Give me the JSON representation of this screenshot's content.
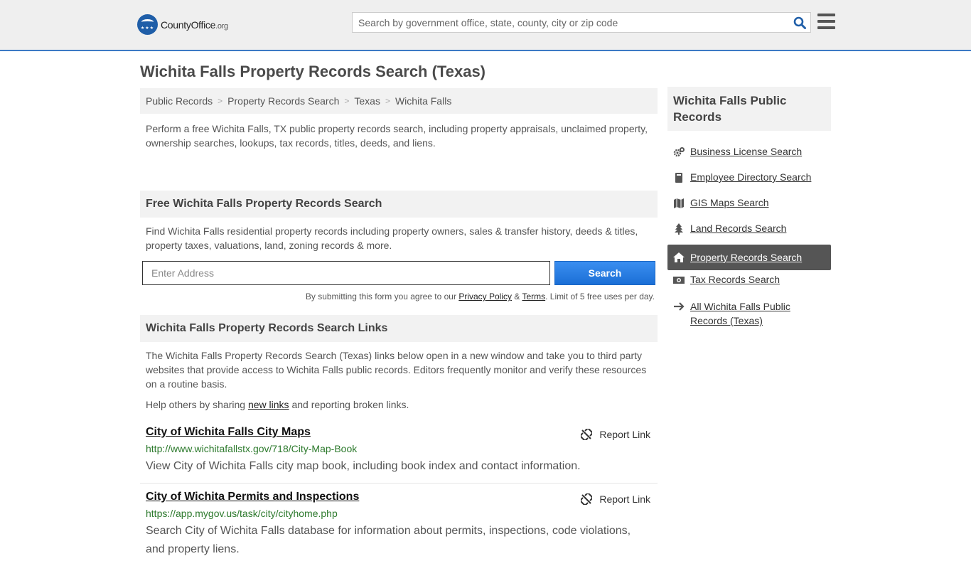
{
  "header": {
    "logo_main": "County",
    "logo_office": "Office",
    "logo_org": ".org",
    "search_placeholder": "Search by government office, state, county, city or zip code"
  },
  "page": {
    "title": "Wichita Falls Property Records Search (Texas)"
  },
  "breadcrumb": [
    "Public Records",
    "Property Records Search",
    "Texas",
    "Wichita Falls"
  ],
  "intro": "Perform a free Wichita Falls, TX public property records search, including property appraisals, unclaimed property, ownership searches, lookups, tax records, titles, deeds, and liens.",
  "free_search": {
    "heading": "Free Wichita Falls Property Records Search",
    "text": "Find Wichita Falls residential property records including property owners, sales & transfer history, deeds & titles, property taxes, valuations, land, zoning records & more.",
    "input_placeholder": "Enter Address",
    "button_label": "Search",
    "terms_prefix": "By submitting this form you agree to our ",
    "privacy_label": "Privacy Policy",
    "terms_amp": " & ",
    "terms_label": "Terms",
    "terms_suffix": ". Limit of 5 free uses per day."
  },
  "links_section": {
    "heading": "Wichita Falls Property Records Search Links",
    "text": "The Wichita Falls Property Records Search (Texas) links below open in a new window and take you to third party websites that provide access to Wichita Falls public records. Editors frequently monitor and verify these resources on a routine basis.",
    "help_prefix": "Help others by sharing ",
    "help_link": "new links",
    "help_suffix": " and reporting broken links.",
    "report_label": "Report Link",
    "items": [
      {
        "title": "City of Wichita Falls City Maps",
        "url": "http://www.wichitafallstx.gov/718/City-Map-Book",
        "desc": "View City of Wichita Falls city map book, including book index and contact information."
      },
      {
        "title": "City of Wichita Permits and Inspections",
        "url": "https://app.mygov.us/task/city/cityhome.php",
        "desc": "Search City of Wichita Falls database for information about permits, inspections, code violations, and property liens."
      }
    ]
  },
  "sidebar": {
    "heading": "Wichita Falls Public Records",
    "items": [
      {
        "label": "Business License Search",
        "icon": "gears-icon"
      },
      {
        "label": "Employee Directory Search",
        "icon": "book-icon"
      },
      {
        "label": "GIS Maps Search",
        "icon": "map-icon"
      },
      {
        "label": "Land Records Search",
        "icon": "tree-icon"
      },
      {
        "label": "Property Records Search",
        "icon": "home-icon",
        "active": true
      },
      {
        "label": "Tax Records Search",
        "icon": "money-icon"
      },
      {
        "label": "All Wichita Falls Public Records (Texas)",
        "icon": "arrow-right-icon"
      }
    ]
  },
  "colors": {
    "accent": "#3c7ac4",
    "button": "#1b6fd6",
    "url_green": "#2d7a2d",
    "active_bg": "#555555"
  }
}
